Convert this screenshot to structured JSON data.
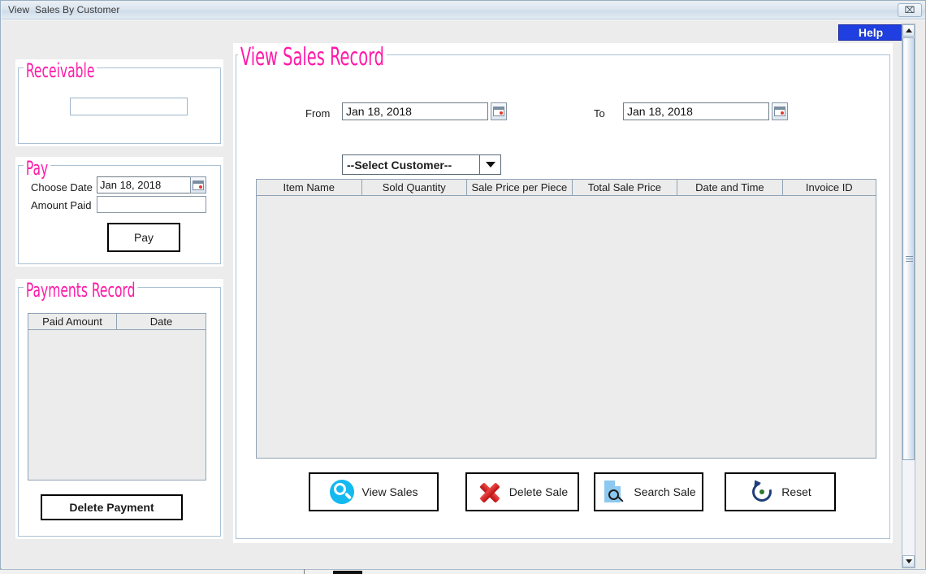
{
  "window": {
    "title": "View  Sales By Customer",
    "close_label": "⌧"
  },
  "help": {
    "label": "Help"
  },
  "left": {
    "receivable": {
      "legend": "Receivable",
      "amount_value": "",
      "amount_placeholder": ""
    },
    "pay": {
      "legend": "Pay",
      "choose_date_label": "Choose Date",
      "choose_date_value": "Jan 18, 2018",
      "amount_paid_label": "Amount Paid",
      "amount_paid_value": "",
      "pay_button": "Pay",
      "calendar_icon": "calendar-icon"
    },
    "payments_record": {
      "legend": "Payments Record",
      "columns": [
        "Paid Amount",
        "Date"
      ],
      "rows": [],
      "delete_button": "Delete Payment"
    }
  },
  "main": {
    "legend": "View Sales Record",
    "from_label": "From",
    "from_value": "Jan 18, 2018",
    "to_label": "To",
    "to_value": "Jan 18, 2018",
    "customer_select": {
      "selected": "--Select Customer--",
      "options": [
        "--Select Customer--"
      ]
    },
    "table": {
      "columns": [
        "Item Name",
        "Sold Quantity",
        "Sale Price per Piece",
        "Total Sale Price",
        "Date and Time",
        "Invoice ID"
      ],
      "rows": []
    },
    "actions": [
      {
        "label": "View Sales",
        "icon": "magnifier-icon"
      },
      {
        "label": "Delete Sale",
        "icon": "red-x-icon"
      },
      {
        "label": "Search Sale",
        "icon": "document-search-icon"
      },
      {
        "label": "Reset",
        "icon": "refresh-icon"
      }
    ]
  },
  "colors": {
    "legend_pink": "#ff1aa8",
    "help_blue": "#1f3fe0",
    "panel_white": "#ffffff",
    "body_gray": "#edecec",
    "table_gray": "#ececec",
    "border_blue": "#aac0d4"
  }
}
